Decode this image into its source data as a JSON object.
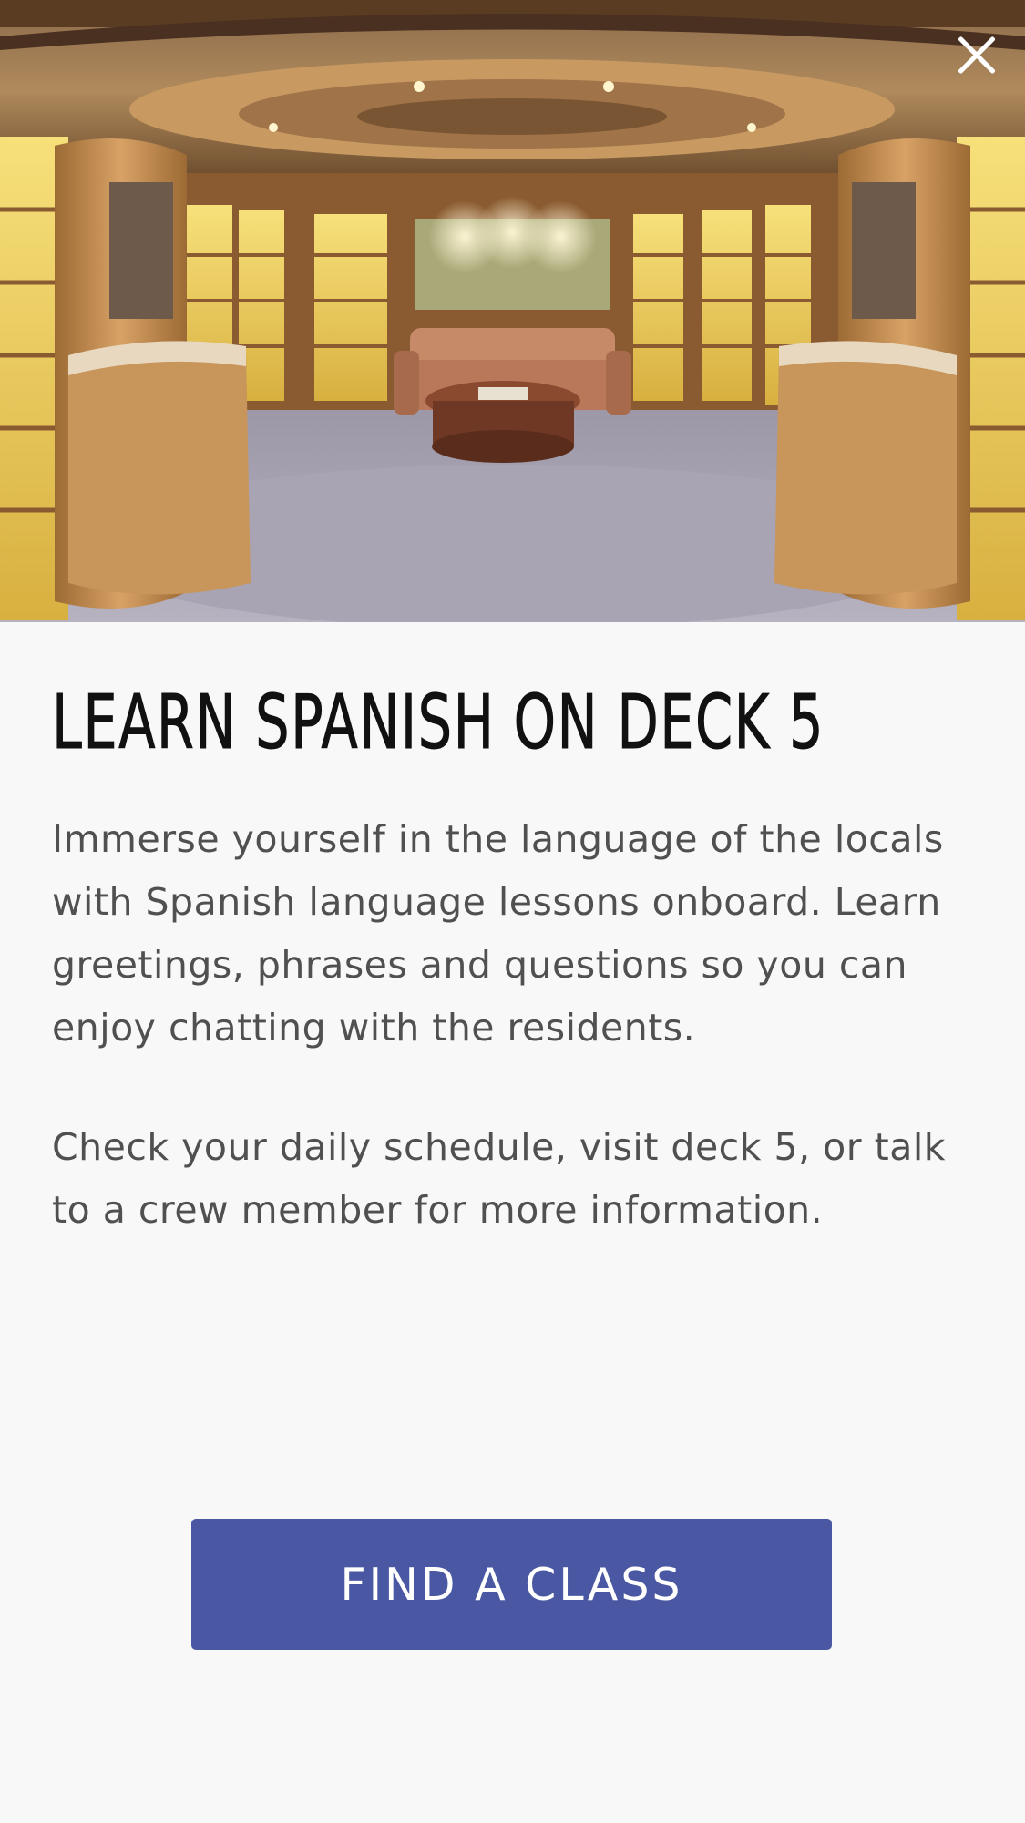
{
  "modal": {
    "hero_image": "library-lounge-photo",
    "close_icon": "close-icon",
    "title": "LEARN SPANISH ON DECK 5",
    "paragraphs": [
      "Immerse yourself in the language of the locals with Spanish language lessons onboard. Learn greetings, phrases and questions so you can enjoy chatting with the residents.",
      "Check your daily schedule, visit deck 5, or talk to a crew member for more information."
    ],
    "cta_label": "FIND A CLASS"
  },
  "colors": {
    "background": "#f8f8f8",
    "title": "#111111",
    "body_text": "#505050",
    "cta_background": "#4a58a3",
    "cta_text": "#ffffff"
  }
}
